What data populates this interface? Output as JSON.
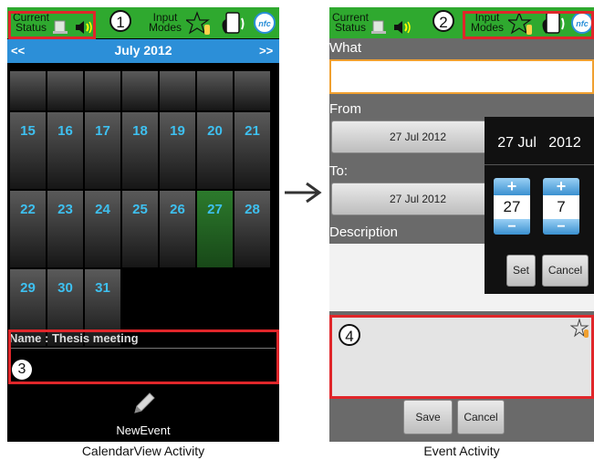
{
  "left_screen": {
    "status_label": "Current\nStatus",
    "input_label": "Input\nModes",
    "marker": "1",
    "nav": {
      "prev": "<<",
      "title": "July 2012",
      "next": ">>"
    },
    "weeks": [
      [
        "",
        "",
        "",
        "",
        "",
        "",
        ""
      ],
      [
        "15",
        "16",
        "17",
        "18",
        "19",
        "20",
        "21"
      ],
      [
        "22",
        "23",
        "24",
        "25",
        "26",
        "27",
        "28"
      ],
      [
        "29",
        "30",
        "31",
        "",
        "",
        "",
        ""
      ]
    ],
    "selected_day": "27",
    "event_panel": {
      "name_line": "Name : Thesis meeting",
      "marker": "3"
    },
    "new_event_label": "NewEvent",
    "caption": "CalendarView Activity"
  },
  "right_screen": {
    "status_label": "Current\nStatus",
    "input_label": "Input\nModes",
    "marker": "2",
    "what_label": "What",
    "from_label": "From",
    "from_date": "27 Jul  2012",
    "to_label": "To:",
    "to_date": "27 Jul  2012",
    "description_label": "Description",
    "picker": {
      "header": "27 Jul   2012",
      "day": "27",
      "month": "7",
      "plus": "+",
      "minus": "−",
      "set": "Set",
      "cancel": "Cancel"
    },
    "gesture_marker": "4",
    "save": "Save",
    "cancel": "Cancel",
    "caption": "Event Activity"
  },
  "icons": [
    "phone-icon",
    "speaker-icon",
    "star-hand-icon",
    "nfc-icon",
    "pencil-icon",
    "arrow-right-icon"
  ],
  "colors": {
    "status_bar": "#2fa92f",
    "highlight_box": "#e0262a",
    "day_number": "#3ec0f0",
    "selected_day": "#1f5a1f",
    "field_focus": "#f0a030"
  }
}
